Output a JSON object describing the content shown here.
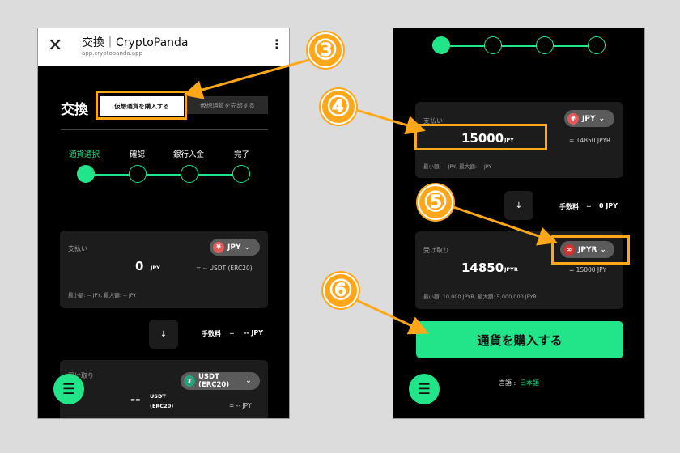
{
  "left": {
    "appbar": {
      "title": "交換｜CryptoPanda",
      "url": "app.cryptopanda.app",
      "close_icon": "close-icon",
      "menu_icon": "kebab-icon"
    },
    "heading": "交換",
    "tabs": {
      "buy": "仮想通貨を購入する",
      "sell": "仮想通貨を売却する"
    },
    "steps": [
      "通貨選択",
      "確認",
      "銀行入金",
      "完了"
    ],
    "pay": {
      "label": "支払い",
      "currency": "JPY",
      "amount": "0",
      "unit": "JPY",
      "rate": "= -- USDT (ERC20)",
      "limits": "最小額: -- JPY, 最大額: -- JPY"
    },
    "fee": {
      "label": "手数料",
      "eq": "=",
      "value": "-- JPY"
    },
    "arrow_glyph": "↓",
    "receive": {
      "label": "受け取り",
      "currency_line1": "USDT",
      "currency_line2": "(ERC20)",
      "amount": "--",
      "unit_line1": "USDT",
      "unit_line2": "(ERC20)",
      "rate": "= -- JPY"
    },
    "menu_glyph": "☰"
  },
  "right": {
    "pay": {
      "label": "支払い",
      "currency": "JPY",
      "amount": "15000",
      "unit": "JPY",
      "rate": "= 14850 JPYR",
      "limits": "最小額: -- JPY, 最大額: -- JPY"
    },
    "fee": {
      "label": "手数料",
      "eq": "=",
      "value": "0 JPY"
    },
    "arrow_glyph": "↓",
    "receive": {
      "label": "受け取り",
      "currency": "JPYR",
      "amount": "14850",
      "unit": "JPYR",
      "rate": "= 15000 JPY",
      "limits": "最小額: 10,000 JPYR, 最大額: 5,000,000 JPYR"
    },
    "buy_button": "通貨を購入する",
    "language": {
      "label": "言語 :",
      "value": "日本語"
    },
    "menu_glyph": "☰"
  },
  "callouts": [
    "③",
    "④",
    "⑤",
    "⑥"
  ],
  "colors": {
    "accent": "#22e58a",
    "highlight": "#ffa71a",
    "background": "#000000"
  }
}
